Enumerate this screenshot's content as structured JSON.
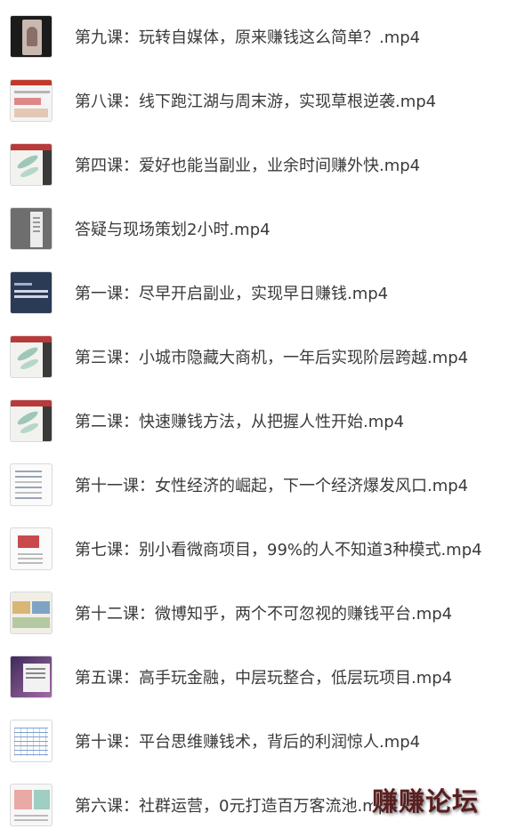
{
  "files": [
    {
      "name": "第九课：玩转自媒体，原来赚钱这么简单？.mp4",
      "thumbnail": "phone-video-thumbnail"
    },
    {
      "name": "第八课：线下跑江湖与周末游，实现草根逆袭.mp4",
      "thumbnail": "webpage-thumbnail"
    },
    {
      "name": "第四课：爱好也能当副业，业余时间赚外快.mp4",
      "thumbnail": "slide-leaf-thumbnail"
    },
    {
      "name": "答疑与现场策划2小时.mp4",
      "thumbnail": "gray-window-thumbnail"
    },
    {
      "name": "第一课：尽早开启副业，实现早日赚钱.mp4",
      "thumbnail": "navy-slide-thumbnail"
    },
    {
      "name": "第三课：小城市隐藏大商机，一年后实现阶层跨越.mp4",
      "thumbnail": "slide-leaf-thumbnail"
    },
    {
      "name": "第二课：快速赚钱方法，从把握人性开始.mp4",
      "thumbnail": "slide-leaf-thumbnail"
    },
    {
      "name": "第十一课：女性经济的崛起，下一个经济爆发风口.mp4",
      "thumbnail": "document-thumbnail"
    },
    {
      "name": "第七课：别小看微商项目，99%的人不知道3种模式.mp4",
      "thumbnail": "red-doc-thumbnail"
    },
    {
      "name": "第十二课：微博知乎，两个不可忽视的赚钱平台.mp4",
      "thumbnail": "mixed-webpage-thumbnail"
    },
    {
      "name": "第五课：高手玩金融，中层玩整合，低层玩项目.mp4",
      "thumbnail": "purple-desktop-thumbnail"
    },
    {
      "name": "第十课：平台思维赚钱术，背后的利润惊人.mp4",
      "thumbnail": "spreadsheet-thumbnail"
    },
    {
      "name": "第六课：社群运营，0元打造百万客流池.mp4",
      "thumbnail": "social-page-thumbnail"
    }
  ],
  "watermark": "赚赚论坛"
}
